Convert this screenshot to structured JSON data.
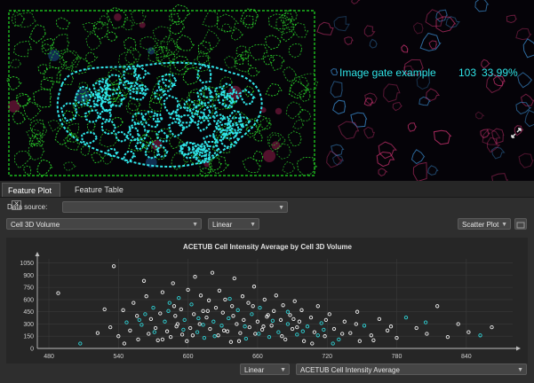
{
  "viewer": {
    "gate_name": "Image gate example",
    "gate_count": "103",
    "gate_percent": "33.99%",
    "gate_color": "#2fe3e6",
    "expand_icon": "expand-arrows-icon"
  },
  "tabs": [
    {
      "label": "Feature Plot",
      "active": true
    },
    {
      "label": "Feature Table",
      "active": false
    }
  ],
  "controls": {
    "data_source_label": "Data source:",
    "data_source_value": "",
    "x_feature": "Cell 3D Volume",
    "x_scale": "Linear",
    "plot_type": "Scatter Plot",
    "y_scale": "Linear",
    "y_feature": "ACETUB Cell Intensity Average"
  },
  "chart_data": {
    "type": "scatter",
    "title": "ACETUB Cell Intensity Average by Cell 3D Volume",
    "xlabel": "",
    "ylabel": "",
    "xlim": [
      470,
      880
    ],
    "ylim": [
      0,
      1100
    ],
    "xticks": [
      480,
      540,
      600,
      660,
      720,
      780,
      840
    ],
    "yticks": [
      0,
      150,
      300,
      450,
      600,
      750,
      900,
      1050
    ],
    "grid": true,
    "colors": {
      "white": "#f0f0f0",
      "cyan": "#2fd3d6"
    },
    "points": [
      [
        488,
        680,
        "w"
      ],
      [
        507,
        60,
        "c"
      ],
      [
        522,
        190,
        "w"
      ],
      [
        528,
        480,
        "w"
      ],
      [
        533,
        260,
        "w"
      ],
      [
        536,
        1010,
        "w"
      ],
      [
        540,
        150,
        "w"
      ],
      [
        544,
        470,
        "w"
      ],
      [
        547,
        320,
        "c"
      ],
      [
        550,
        220,
        "w"
      ],
      [
        553,
        560,
        "w"
      ],
      [
        556,
        400,
        "w"
      ],
      [
        557,
        110,
        "w"
      ],
      [
        560,
        290,
        "c"
      ],
      [
        562,
        830,
        "w"
      ],
      [
        564,
        640,
        "w"
      ],
      [
        566,
        180,
        "w"
      ],
      [
        568,
        360,
        "w"
      ],
      [
        570,
        500,
        "c"
      ],
      [
        572,
        250,
        "w"
      ],
      [
        574,
        100,
        "w"
      ],
      [
        576,
        430,
        "w"
      ],
      [
        578,
        690,
        "w"
      ],
      [
        580,
        330,
        "c"
      ],
      [
        582,
        210,
        "w"
      ],
      [
        584,
        560,
        "c"
      ],
      [
        585,
        140,
        "w"
      ],
      [
        587,
        800,
        "w"
      ],
      [
        589,
        400,
        "w"
      ],
      [
        590,
        270,
        "w"
      ],
      [
        592,
        620,
        "c"
      ],
      [
        594,
        480,
        "w"
      ],
      [
        595,
        170,
        "w"
      ],
      [
        597,
        350,
        "c"
      ],
      [
        599,
        90,
        "w"
      ],
      [
        600,
        720,
        "w"
      ],
      [
        602,
        250,
        "w"
      ],
      [
        603,
        540,
        "c"
      ],
      [
        605,
        420,
        "w"
      ],
      [
        606,
        880,
        "w"
      ],
      [
        608,
        200,
        "c"
      ],
      [
        610,
        300,
        "w"
      ],
      [
        611,
        650,
        "w"
      ],
      [
        613,
        460,
        "w"
      ],
      [
        614,
        130,
        "c"
      ],
      [
        616,
        380,
        "w"
      ],
      [
        618,
        590,
        "w"
      ],
      [
        619,
        240,
        "w"
      ],
      [
        621,
        930,
        "w"
      ],
      [
        622,
        330,
        "c"
      ],
      [
        624,
        500,
        "w"
      ],
      [
        626,
        160,
        "w"
      ],
      [
        627,
        710,
        "w"
      ],
      [
        629,
        280,
        "c"
      ],
      [
        630,
        440,
        "w"
      ],
      [
        632,
        600,
        "w"
      ],
      [
        634,
        210,
        "w"
      ],
      [
        635,
        370,
        "c"
      ],
      [
        637,
        80,
        "w"
      ],
      [
        638,
        520,
        "w"
      ],
      [
        640,
        860,
        "w"
      ],
      [
        642,
        300,
        "w"
      ],
      [
        643,
        470,
        "c"
      ],
      [
        645,
        190,
        "w"
      ],
      [
        647,
        640,
        "w"
      ],
      [
        648,
        350,
        "w"
      ],
      [
        650,
        120,
        "c"
      ],
      [
        652,
        560,
        "w"
      ],
      [
        653,
        260,
        "w"
      ],
      [
        655,
        420,
        "c"
      ],
      [
        657,
        760,
        "w"
      ],
      [
        658,
        180,
        "w"
      ],
      [
        660,
        330,
        "w"
      ],
      [
        662,
        500,
        "c"
      ],
      [
        664,
        230,
        "w"
      ],
      [
        666,
        600,
        "w"
      ],
      [
        668,
        390,
        "w"
      ],
      [
        670,
        140,
        "c"
      ],
      [
        672,
        280,
        "w"
      ],
      [
        674,
        460,
        "w"
      ],
      [
        676,
        650,
        "w"
      ],
      [
        678,
        200,
        "c"
      ],
      [
        680,
        350,
        "w"
      ],
      [
        682,
        530,
        "w"
      ],
      [
        684,
        110,
        "w"
      ],
      [
        686,
        300,
        "c"
      ],
      [
        688,
        410,
        "w"
      ],
      [
        690,
        240,
        "w"
      ],
      [
        692,
        580,
        "w"
      ],
      [
        694,
        170,
        "c"
      ],
      [
        696,
        330,
        "w"
      ],
      [
        698,
        470,
        "w"
      ],
      [
        700,
        90,
        "w"
      ],
      [
        703,
        270,
        "c"
      ],
      [
        706,
        380,
        "w"
      ],
      [
        709,
        200,
        "w"
      ],
      [
        712,
        520,
        "w"
      ],
      [
        715,
        310,
        "c"
      ],
      [
        718,
        150,
        "w"
      ],
      [
        722,
        420,
        "w"
      ],
      [
        726,
        240,
        "w"
      ],
      [
        730,
        110,
        "c"
      ],
      [
        735,
        330,
        "w"
      ],
      [
        740,
        190,
        "w"
      ],
      [
        746,
        450,
        "w"
      ],
      [
        752,
        280,
        "c"
      ],
      [
        758,
        160,
        "w"
      ],
      [
        765,
        360,
        "w"
      ],
      [
        772,
        220,
        "w"
      ],
      [
        780,
        130,
        "w"
      ],
      [
        788,
        380,
        "c"
      ],
      [
        797,
        250,
        "w"
      ],
      [
        806,
        180,
        "w"
      ],
      [
        815,
        520,
        "w"
      ],
      [
        824,
        140,
        "w"
      ],
      [
        833,
        300,
        "w"
      ],
      [
        842,
        200,
        "w"
      ],
      [
        852,
        160,
        "c"
      ],
      [
        862,
        260,
        "w"
      ],
      [
        545,
        60,
        "w"
      ],
      [
        558,
        350,
        "c"
      ],
      [
        571,
        200,
        "c"
      ],
      [
        583,
        460,
        "c"
      ],
      [
        596,
        230,
        "c"
      ],
      [
        609,
        370,
        "c"
      ],
      [
        623,
        150,
        "c"
      ],
      [
        636,
        610,
        "c"
      ],
      [
        649,
        270,
        "c"
      ],
      [
        661,
        180,
        "c"
      ],
      [
        673,
        340,
        "c"
      ],
      [
        686,
        450,
        "c"
      ],
      [
        699,
        210,
        "c"
      ],
      [
        712,
        160,
        "c"
      ],
      [
        725,
        60,
        "c"
      ],
      [
        760,
        100,
        "w"
      ],
      [
        578,
        110,
        "w"
      ],
      [
        591,
        300,
        "w"
      ],
      [
        604,
        160,
        "w"
      ],
      [
        617,
        460,
        "w"
      ],
      [
        631,
        220,
        "w"
      ],
      [
        644,
        90,
        "w"
      ],
      [
        656,
        520,
        "w"
      ],
      [
        669,
        410,
        "w"
      ],
      [
        681,
        150,
        "w"
      ],
      [
        694,
        260,
        "w"
      ],
      [
        707,
        60,
        "w"
      ],
      [
        719,
        350,
        "w"
      ],
      [
        733,
        180,
        "w"
      ],
      [
        748,
        90,
        "w"
      ],
      [
        563,
        420,
        "c"
      ],
      [
        588,
        520,
        "w"
      ],
      [
        613,
        290,
        "c"
      ],
      [
        639,
        400,
        "w"
      ],
      [
        665,
        270,
        "w"
      ],
      [
        691,
        360,
        "w"
      ],
      [
        717,
        230,
        "c"
      ],
      [
        745,
        300,
        "w"
      ],
      [
        775,
        270,
        "w"
      ],
      [
        805,
        320,
        "c"
      ]
    ]
  }
}
